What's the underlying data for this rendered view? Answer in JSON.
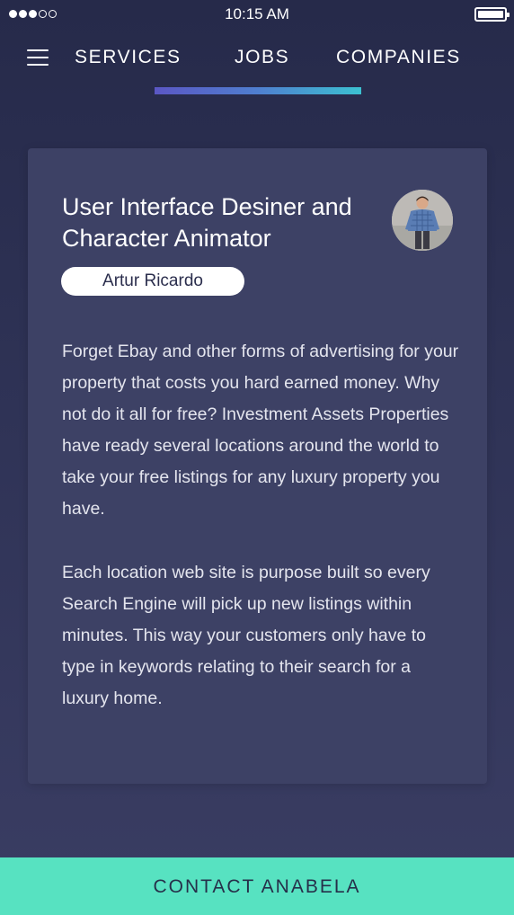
{
  "status_bar": {
    "time": "10:15 AM",
    "signal_strength": 3,
    "signal_max": 5,
    "battery_level": 1.0
  },
  "nav": {
    "menu_icon": "hamburger-icon",
    "tabs": [
      {
        "label": "SERVICES"
      },
      {
        "label": "JOBS",
        "active": true
      },
      {
        "label": "COMPANIES"
      }
    ],
    "indicator_colors": [
      "#5b57c4",
      "#3cc1d1"
    ]
  },
  "card": {
    "title": "User Interface Desiner and Character Animator",
    "author": "Artur Ricardo",
    "avatar_icon": "user-avatar-icon",
    "paragraphs": [
      "Forget Ebay and other forms of advertising for your property that costs you hard earned money. Why not do it all for free? Investment Assets Properties have ready several locations around the world to take your free listings for any luxury property you have.",
      "Each location web site is purpose built so every Search Engine will pick up new listings within minutes. This way your customers only have to type in keywords relating to their search for a luxury home."
    ]
  },
  "contact": {
    "label": "CONTACT ANABELA",
    "color": "#57e2c1"
  }
}
